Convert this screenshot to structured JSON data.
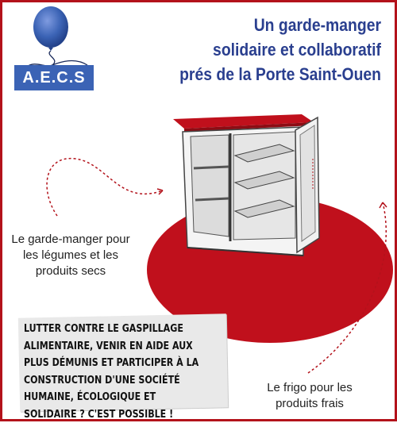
{
  "logo": {
    "text": "A.E.C.S",
    "balloon_color": "#3b63b5"
  },
  "title": {
    "line1": "Un garde-manger",
    "line2": "solidaire et collaboratif",
    "line3": "prés de la Porte Saint-Ouen"
  },
  "captions": {
    "left": "Le garde-manger pour les légumes et les produits secs",
    "right": "Le frigo pour les produits frais"
  },
  "banner": {
    "text": "Lutter contre le gaspillage alimentaire, venir en aide aux plus démunis et participer à la construction d'une société humaine, écologique et solidaire ? C'est possible !"
  },
  "colors": {
    "frame": "#b3121b",
    "disc": "#c0101c",
    "title": "#2a3f8f",
    "logo_box": "#3b63b5"
  }
}
